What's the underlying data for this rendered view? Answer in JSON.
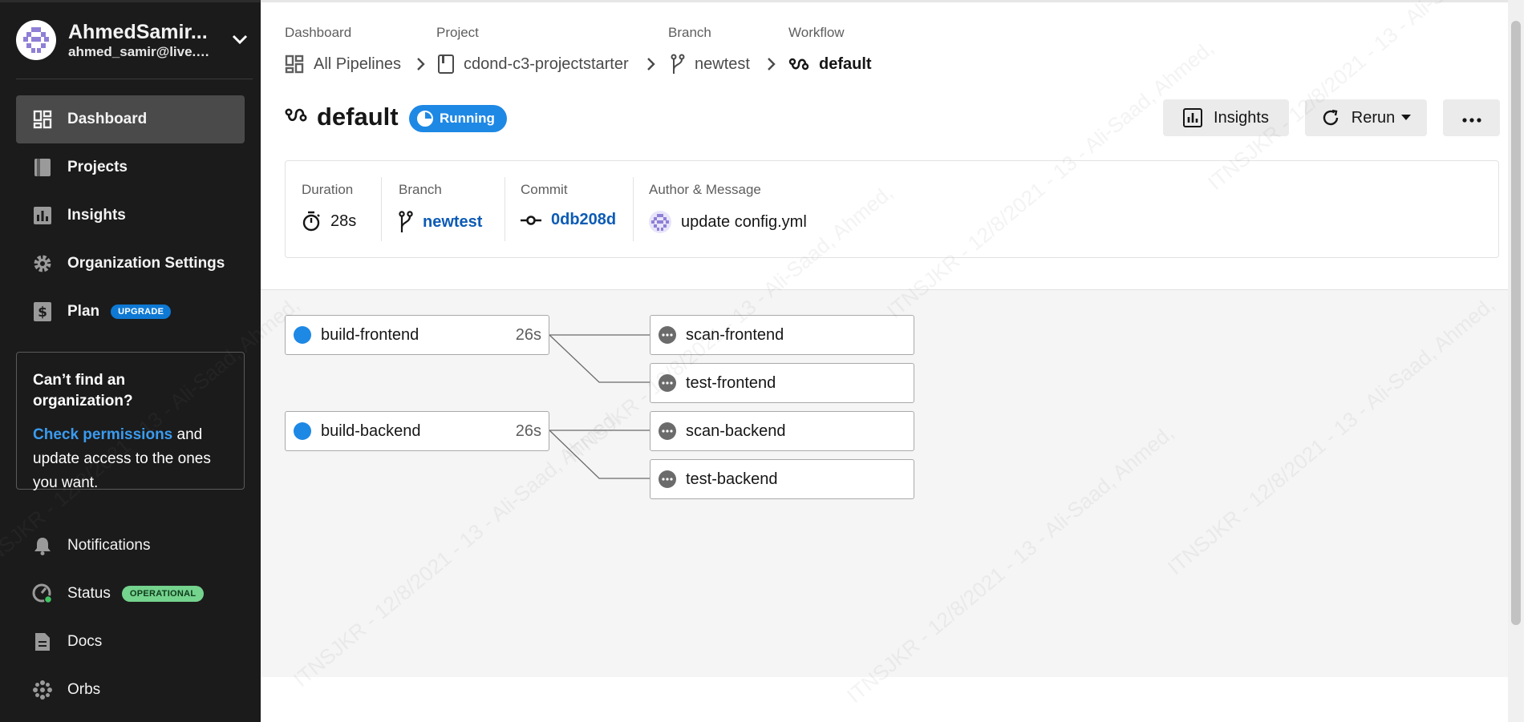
{
  "account": {
    "name": "AhmedSamir...",
    "email": "ahmed_samir@live.c..."
  },
  "sidebar": {
    "items": [
      {
        "label": "Dashboard",
        "icon": "dashboard-icon",
        "active": true
      },
      {
        "label": "Projects",
        "icon": "projects-icon"
      },
      {
        "label": "Insights",
        "icon": "insights-icon"
      },
      {
        "label": "Organization Settings",
        "icon": "gear-icon"
      },
      {
        "label": "Plan",
        "icon": "dollar-icon",
        "badge": "UPGRADE"
      }
    ],
    "org_card": {
      "title": "Can’t find an organization?",
      "link": "Check permissions",
      "text": " and update access to the ones you want."
    },
    "bottom_items": [
      {
        "label": "Notifications",
        "icon": "bell-icon"
      },
      {
        "label": "Status",
        "icon": "status-gauge-icon",
        "badge": "OPERATIONAL"
      },
      {
        "label": "Docs",
        "icon": "docs-icon"
      },
      {
        "label": "Orbs",
        "icon": "orbs-icon"
      }
    ]
  },
  "breadcrumb": {
    "labels": [
      "Dashboard",
      "Project",
      "Branch",
      "Workflow"
    ],
    "items": [
      "All Pipelines",
      "cdond-c3-projectstarter",
      "newtest",
      "default"
    ]
  },
  "workflow": {
    "name": "default",
    "status": "Running"
  },
  "actions": {
    "insights": "Insights",
    "rerun": "Rerun",
    "more": "more-icon"
  },
  "summary": {
    "duration_label": "Duration",
    "duration": "28s",
    "branch_label": "Branch",
    "branch": "newtest",
    "commit_label": "Commit",
    "commit": "0db208d",
    "author_label": "Author & Message",
    "message": "update config.yml"
  },
  "jobs": [
    {
      "name": "build-frontend",
      "duration": "26s",
      "status": "running"
    },
    {
      "name": "scan-frontend",
      "status": "queued"
    },
    {
      "name": "test-frontend",
      "status": "queued"
    },
    {
      "name": "build-backend",
      "duration": "26s",
      "status": "running"
    },
    {
      "name": "scan-backend",
      "status": "queued"
    },
    {
      "name": "test-backend",
      "status": "queued"
    }
  ],
  "watermark": "ITNSJKR - 12/8/2021 - 13 - Ali-Saad, Ahmed,",
  "colors": {
    "sidebar_bg": "#1b1b1b",
    "accent_blue": "#1e88e5",
    "link_blue": "#0d5bb5",
    "upgrade_badge": "#0e79d4",
    "operational_badge": "#74d38d"
  }
}
